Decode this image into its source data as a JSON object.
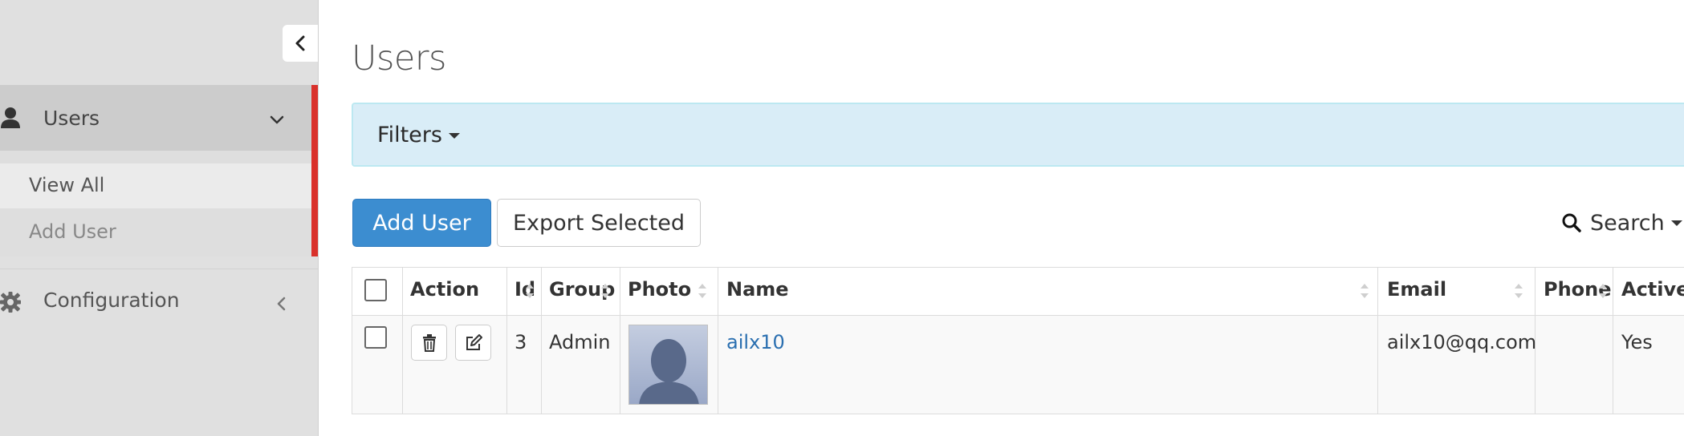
{
  "sidebar": {
    "collapse_icon": "chevron-left-icon",
    "users": {
      "label": "Users",
      "icon": "user-icon",
      "expand_icon": "chevron-down-icon"
    },
    "submenu": [
      {
        "label": "View All"
      },
      {
        "label": "Add User"
      }
    ],
    "configuration": {
      "label": "Configuration",
      "icon": "gear-icon",
      "expand_icon": "chevron-left-icon"
    },
    "active_color": "#d9312b"
  },
  "main": {
    "title": "Users",
    "filters_label": "Filters",
    "toolbar": {
      "add_label": "Add User",
      "export_label": "Export Selected",
      "search_label": "Search"
    },
    "table": {
      "columns": [
        "Action",
        "Id",
        "Group",
        "Photo",
        "Name",
        "Email",
        "Phone",
        "Active?"
      ],
      "rows": [
        {
          "id": "3",
          "group": "Admin",
          "photo": "avatar-placeholder",
          "name": "ailx10",
          "email": "ailx10@qq.com",
          "phone": "",
          "active": "Yes"
        }
      ]
    }
  },
  "colors": {
    "primary": "#3c8dd0",
    "filters_bg": "#d9edf7",
    "link": "#2a6fb0"
  }
}
